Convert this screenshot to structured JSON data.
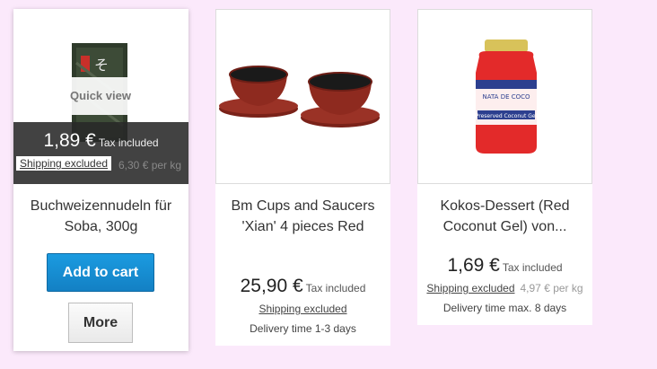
{
  "products": [
    {
      "name": "Buchweizennudeln für Soba, 300g",
      "quick_view": "Quick view",
      "price": "1,89 €",
      "tax": "Tax included",
      "shipping": "Shipping excluded",
      "per_kg": "6,30 € per kg",
      "add_to_cart": "Add to cart",
      "more": "More"
    },
    {
      "name": "Bm Cups and Saucers 'Xian' 4 pieces Red",
      "price": "25,90 €",
      "tax": "Tax included",
      "shipping": "Shipping excluded",
      "delivery": "Delivery time 1-3 days"
    },
    {
      "name": "Kokos-Dessert (Red Coconut Gel) von...",
      "price": "1,69 €",
      "tax": "Tax included",
      "shipping": "Shipping excluded",
      "per_kg": "4,97 € per kg",
      "delivery": "Delivery time max. 8 days",
      "jar_label_top": "NATA DE COCO",
      "jar_label_bottom": "Preserved Coconut Gel"
    }
  ],
  "colors": {
    "page_bg": "#fbe9fb",
    "cart_button": "#1a8fd6",
    "cups": "#8e2a1f",
    "gel": "#e32a2a"
  }
}
